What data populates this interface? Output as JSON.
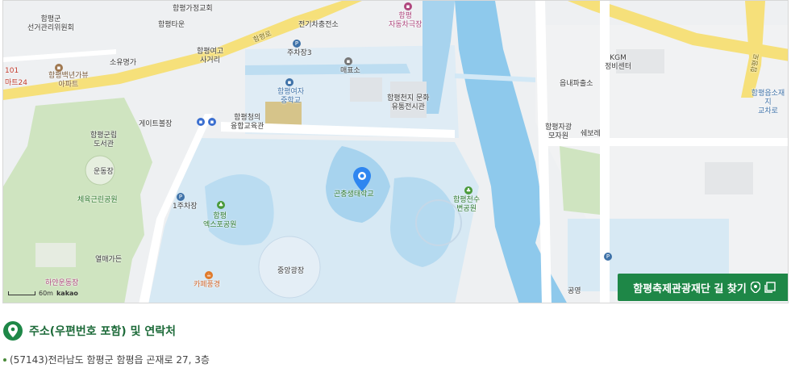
{
  "map": {
    "labels": {
      "hampyeong_gun_election": "함평군\n선거관리위원회",
      "church": "함평가정교회",
      "hampyeong_town": "함평타운",
      "electric_charging": "전기차충전소",
      "auto_theater": "함평\n자동차극장",
      "parking3": "주차장3",
      "soyu_myeongga": "소유명가",
      "mart24": "마트24",
      "mart24_num": "101",
      "baekyeon_apt": "함평백년가뷰\n아파트",
      "jangnyeom_road": "함평여고\n사거리",
      "ticket_office": "매표소",
      "girls_middle": "함평여자\n중학교",
      "library": "함평군립\n도서관",
      "gate_ball": "게이트볼장",
      "jungheung": "함평청의\n융합교육관",
      "culture_hall": "함평천지 문화\n유통전시관",
      "kgm": "KGM\n정비센터",
      "police": "읍내파출소",
      "jawang_cemetery": "함평자광\n모자원",
      "bukbori": "쉐보레",
      "school_cross": "함평읍소재지\n교차로",
      "undongjang": "운동장",
      "park_cheyuk": "체육근린공원",
      "parking1": "1주차장",
      "expo_park": "함평\n엑스포공원",
      "ecology_school": "곤충생태학교",
      "riverside_park": "함평천수\n변공원",
      "main_plaza": "중앙광장",
      "cafe": "카페풍경",
      "yeolmae_garden": "열매가든",
      "public_office": "공영",
      "stadium": "하얀운동장",
      "road_name": "함평로",
      "road_name2": "함평로"
    },
    "scale_text": "60m",
    "brand": "kakao"
  },
  "route_button": {
    "label": "함평축제관광재단 길 찾기"
  },
  "section": {
    "title": "주소(우편번호 포함) 및 연락처"
  },
  "address": {
    "text": "(57143)전라남도 함평군 함평읍 곤재로 27, 3층"
  },
  "colors": {
    "brand_green": "#1e8747",
    "water": "#8ec9ec",
    "park": "#cfe4c0",
    "marker": "#2f86f0"
  }
}
